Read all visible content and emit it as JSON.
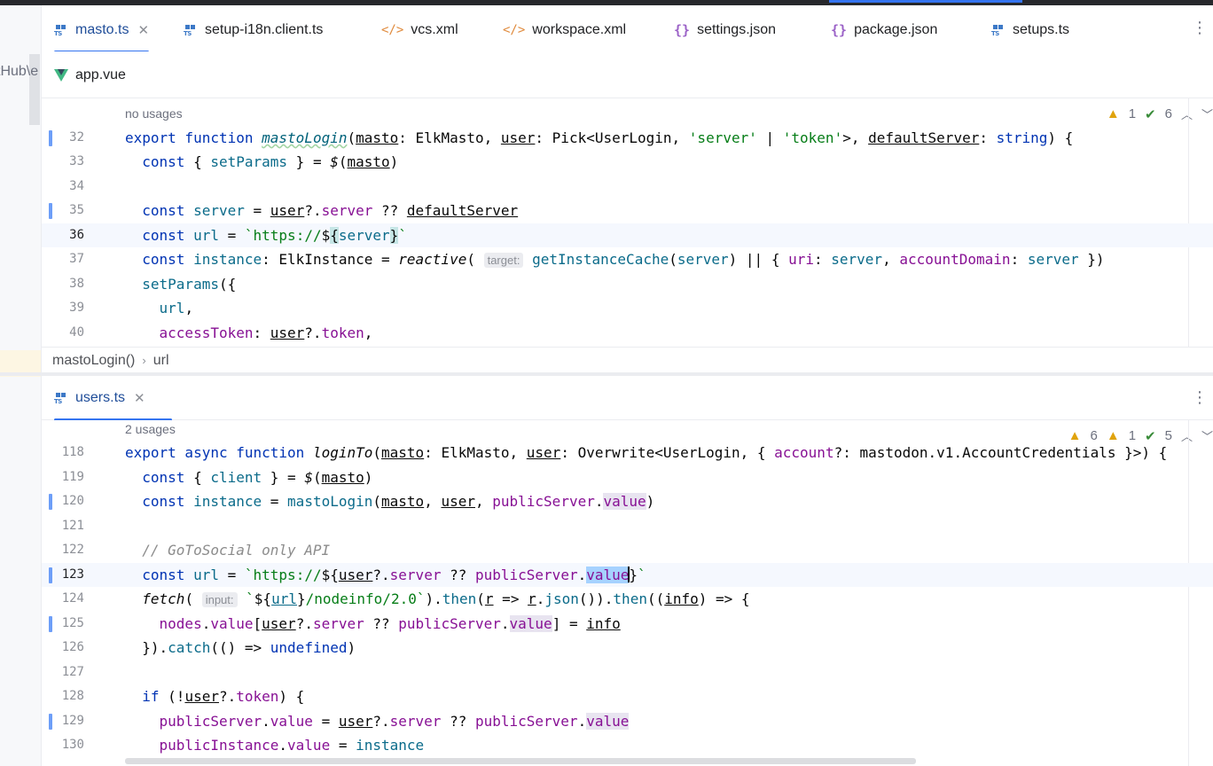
{
  "sidebar": {
    "fragment": "tHub\\e"
  },
  "top_pane": {
    "tabs": [
      {
        "label": "masto.ts",
        "icon": "ts-file-icon",
        "active": true
      },
      {
        "label": "setup-i18n.client.ts",
        "icon": "ts-file-icon"
      },
      {
        "label": "vcs.xml",
        "icon": "xml-file-icon"
      },
      {
        "label": "workspace.xml",
        "icon": "xml-file-icon"
      },
      {
        "label": "settings.json",
        "icon": "json-file-icon"
      },
      {
        "label": "package.json",
        "icon": "json-file-icon"
      },
      {
        "label": "setups.ts",
        "icon": "ts-file-icon"
      }
    ],
    "second_row_tab": {
      "label": "app.vue",
      "icon": "vue-file-icon"
    },
    "usage_hint": "no usages",
    "inspections": {
      "warnings": "1",
      "ok": "6"
    },
    "breadcrumb": [
      "mastoLogin()",
      "url"
    ],
    "line_numbers": [
      "32",
      "33",
      "34",
      "35",
      "36",
      "37",
      "38",
      "39",
      "40"
    ],
    "inlay_target": "target:"
  },
  "bottom_pane": {
    "tab": {
      "label": "users.ts",
      "icon": "ts-file-icon"
    },
    "usage_hint": "2 usages",
    "inspections": {
      "errors": "6",
      "warnings": "1",
      "ok": "5"
    },
    "line_numbers": [
      "118",
      "119",
      "120",
      "121",
      "122",
      "123",
      "124",
      "125",
      "126",
      "127",
      "128",
      "129",
      "130"
    ],
    "inlay_input": "input:"
  },
  "colors": {
    "accent": "#3574f0",
    "keyword": "#0033b3",
    "string": "#067d17",
    "property": "#871094",
    "warning": "#e0a30e"
  }
}
